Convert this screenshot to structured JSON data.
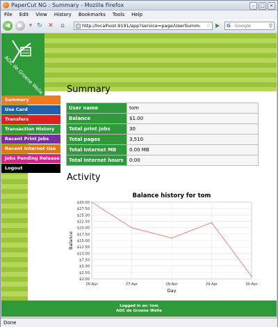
{
  "window": {
    "title": "PaperCut NG : Summary - Mozilla Firefox"
  },
  "menu_bar": [
    "File",
    "Edit",
    "View",
    "History",
    "Bookmarks",
    "Tools",
    "Help"
  ],
  "toolbar": {
    "url": "http://localhost:9191/app?service=page/UserSummary",
    "search_placeholder": "Google"
  },
  "logo": {
    "text": "AOC de Groene Welle"
  },
  "nav": [
    {
      "label": "Summary",
      "color": "#f07a1e"
    },
    {
      "label": "Use Card",
      "color": "#1f5fb0"
    },
    {
      "label": "Transfers",
      "color": "#e02020"
    },
    {
      "label": "Transaction History",
      "color": "#2e9a3a"
    },
    {
      "label": "Recent Print Jobs",
      "color": "#7a2ea0"
    },
    {
      "label": "Recent Internet Use",
      "color": "#e07a10"
    },
    {
      "label": "Jobs Pending Release",
      "color": "#e0208a"
    },
    {
      "label": "Logout",
      "color": "#000000"
    }
  ],
  "page": {
    "title": "Summary",
    "activity_title": "Activity"
  },
  "summary": [
    {
      "key": "User name",
      "value": "tom"
    },
    {
      "key": "Balance",
      "value": "$1.00"
    },
    {
      "key": "Total print jobs",
      "value": "30"
    },
    {
      "key": "Total pages",
      "value": "3,510"
    },
    {
      "key": "Total Internet MB",
      "value": "0.00 MB"
    },
    {
      "key": "Total Internet hours",
      "value": "0:00"
    }
  ],
  "chart_data": {
    "type": "line",
    "title": "Balance history for tom",
    "xlabel": "Day",
    "ylabel": "Balance",
    "categories": [
      "26-Apr",
      "27-Apr",
      "28-Apr",
      "29-Apr",
      "30-Apr"
    ],
    "values": [
      30.0,
      20.0,
      16.0,
      22.0,
      1.0
    ],
    "yticks": [
      "$0.00",
      "$2.50",
      "$5.00",
      "$7.50",
      "$10.00",
      "$12.50",
      "$15.00",
      "$17.50",
      "$20.00",
      "$22.50",
      "$25.00",
      "$27.50",
      "$30.00"
    ],
    "ylim": [
      0,
      30
    ],
    "grid": true,
    "line_color": "#f08070"
  },
  "footer": {
    "line1": "Logged in as:  tom",
    "line2": "AOC de Groene Welle"
  },
  "status": {
    "text": "Done"
  }
}
